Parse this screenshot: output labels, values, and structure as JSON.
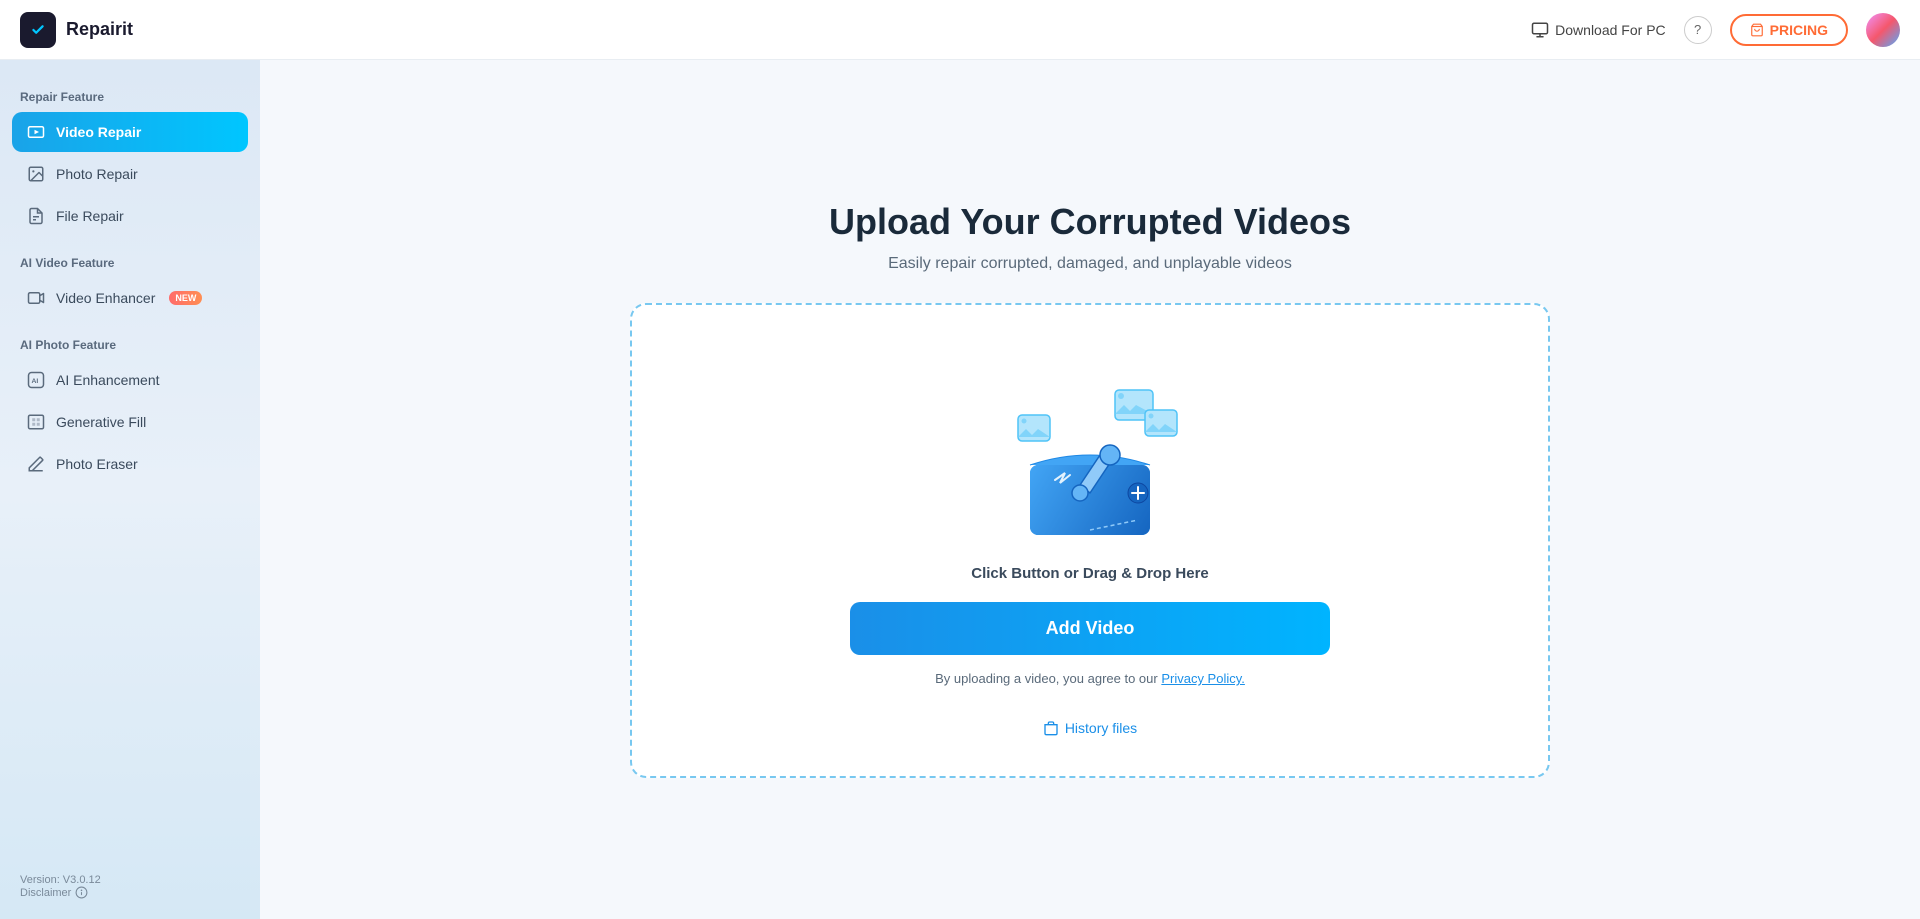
{
  "app": {
    "name": "Repairit"
  },
  "header": {
    "download_label": "Download For PC",
    "pricing_label": "PRICING"
  },
  "sidebar": {
    "repair_feature_label": "Repair Feature",
    "ai_video_feature_label": "AI Video Feature",
    "ai_photo_feature_label": "AI Photo Feature",
    "items": [
      {
        "id": "video-repair",
        "label": "Video Repair",
        "active": true
      },
      {
        "id": "photo-repair",
        "label": "Photo Repair",
        "active": false
      },
      {
        "id": "file-repair",
        "label": "File Repair",
        "active": false
      },
      {
        "id": "video-enhancer",
        "label": "Video Enhancer",
        "active": false,
        "badge": "NEW"
      },
      {
        "id": "ai-enhancement",
        "label": "AI Enhancement",
        "active": false
      },
      {
        "id": "generative-fill",
        "label": "Generative Fill",
        "active": false
      },
      {
        "id": "photo-eraser",
        "label": "Photo Eraser",
        "active": false
      }
    ],
    "version_label": "Version: V3.0.12",
    "disclaimer_label": "Disclaimer"
  },
  "main": {
    "title": "Upload Your Corrupted Videos",
    "subtitle": "Easily repair corrupted, damaged, and unplayable videos",
    "drop_hint": "Click Button or Drag & Drop Here",
    "add_video_label": "Add Video",
    "privacy_text": "By uploading a video, you agree to our ",
    "privacy_link": "Privacy Policy.",
    "history_label": "History files"
  }
}
